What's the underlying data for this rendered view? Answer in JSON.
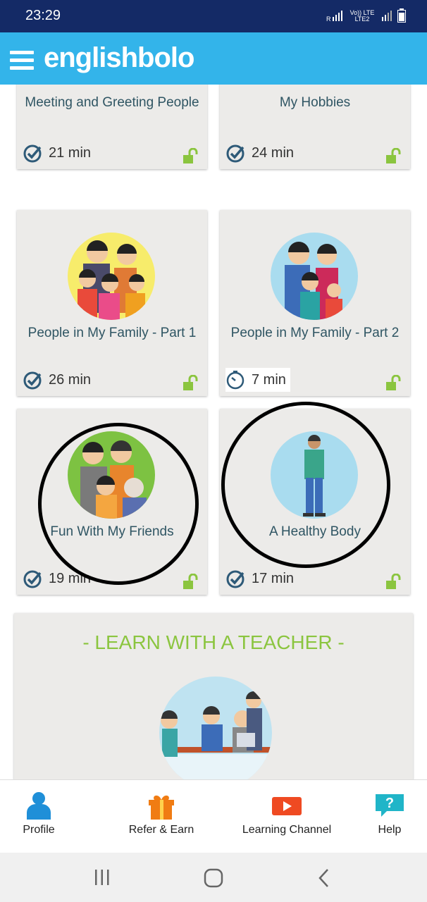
{
  "status_bar": {
    "time": "23:29",
    "net1": "R",
    "net2": "Vo)) LTE",
    "net3": "LTE2",
    "net4": "LTE"
  },
  "app": {
    "logo": "englishbolo",
    "brand_color": "#33b4ea"
  },
  "lessons": [
    {
      "title": "Meeting and Greeting People",
      "duration": "21 min"
    },
    {
      "title": "My Hobbies",
      "duration": "24 min"
    },
    {
      "title": "People in My Family - Part 1",
      "duration": "26 min"
    },
    {
      "title": "People in My Family - Part 2",
      "duration": "7 min"
    },
    {
      "title": "Fun With My Friends",
      "duration": "19 min"
    },
    {
      "title": "A Healthy Body",
      "duration": "17 min"
    }
  ],
  "teacher_section": {
    "title": "-  LEARN WITH A TEACHER  -"
  },
  "bottom_nav": {
    "profile": "Profile",
    "refer": "Refer & Earn",
    "channel": "Learning Channel",
    "help": "Help"
  },
  "colors": {
    "accent_green": "#8bc53f",
    "status_bar": "#142a66",
    "nav_blue": "#1f8fd8",
    "nav_orange": "#f07c13",
    "nav_red": "#ef4a22",
    "nav_teal": "#20b5c8"
  }
}
